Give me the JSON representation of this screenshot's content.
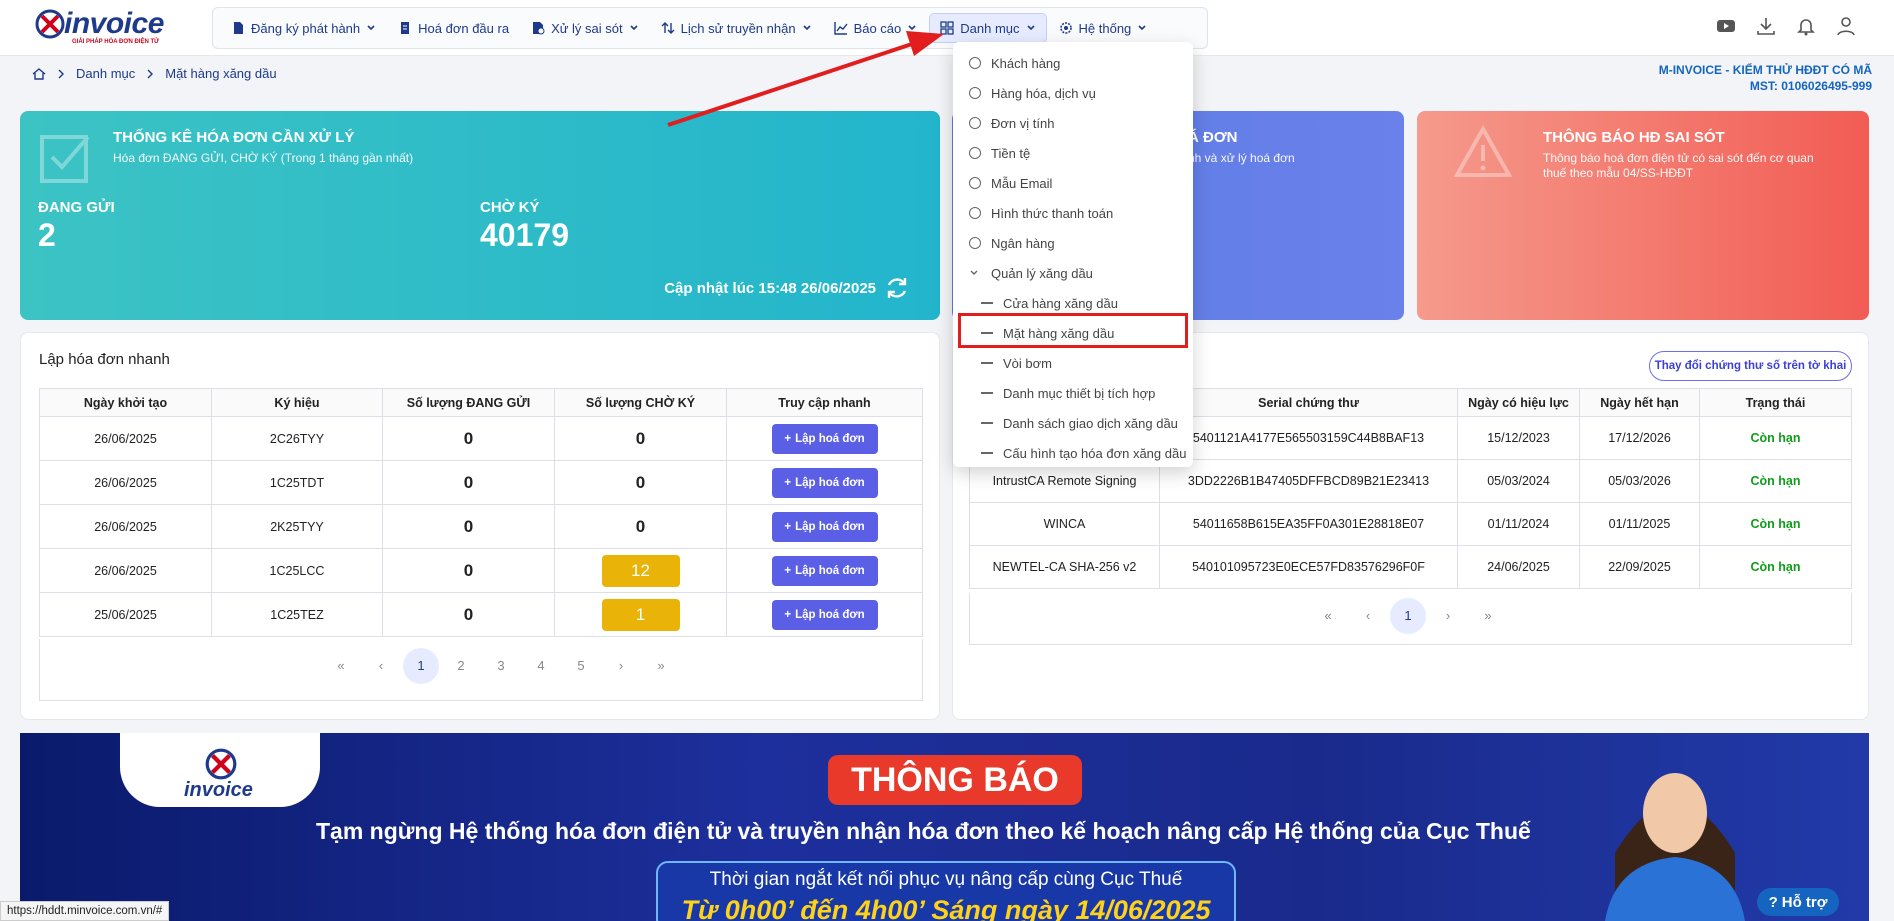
{
  "header": {
    "logo_text": "invoice",
    "logo_tagline": "GIẢI PHÁP HÓA ĐƠN ĐIỆN TỬ",
    "nav": [
      {
        "label": "Đăng ký phát hành",
        "icon": "file-register-icon"
      },
      {
        "label": "Hoá đơn đầu ra",
        "icon": "invoice-out-icon"
      },
      {
        "label": "Xử lý sai sót",
        "icon": "error-handling-icon"
      },
      {
        "label": "Lịch sử truyền nhận",
        "icon": "transfer-history-icon"
      },
      {
        "label": "Báo cáo",
        "icon": "chart-icon"
      },
      {
        "label": "Danh mục",
        "icon": "grid-icon"
      },
      {
        "label": "Hệ thống",
        "icon": "gear-icon"
      }
    ]
  },
  "breadcrumb": [
    "Danh mục",
    "Mặt hàng xăng dầu"
  ],
  "company": {
    "name": "M-INVOICE - KIỂM THỬ HĐĐT CÓ MÃ",
    "tax": "MST: 0106026495-999"
  },
  "stats": {
    "title": "THỐNG KÊ HÓA ĐƠN CẦN XỬ LÝ",
    "subtitle": "Hóa đơn ĐANG GỬI, CHỜ KÝ (Trong 1 tháng gần nhất)",
    "sending_label": "ĐANG GỬI",
    "sending_value": "2",
    "pending_label": "CHỜ KÝ",
    "pending_value": "40179",
    "updated": "Cập nhật lúc 15:48 26/06/2025"
  },
  "card2": {
    "title_partial": "Á ĐƠN",
    "sub_partial": "nh và xử lý hoá đơn"
  },
  "card3": {
    "title": "THÔNG BÁO HĐ SAI SÓT",
    "sub1": "Thông báo hoá đơn điện tử có sai sót đến cơ quan",
    "sub2": "thuế theo mẫu 04/SS-HĐĐT"
  },
  "quick": {
    "title": "Lập hóa đơn nhanh",
    "columns": [
      "Ngày khởi tạo",
      "Ký hiệu",
      "Số lượng ĐANG GỬI",
      "Số lượng CHỜ KÝ",
      "Truy cập nhanh"
    ],
    "button_label": "Lập hoá đơn",
    "rows": [
      {
        "date": "26/06/2025",
        "code": "2C26TYY",
        "sending": "0",
        "pending": "0"
      },
      {
        "date": "26/06/2025",
        "code": "1C25TDT",
        "sending": "0",
        "pending": "0"
      },
      {
        "date": "26/06/2025",
        "code": "2K25TYY",
        "sending": "0",
        "pending": "0"
      },
      {
        "date": "26/06/2025",
        "code": "1C25LCC",
        "sending": "0",
        "pending": "12"
      },
      {
        "date": "25/06/2025",
        "code": "1C25TEZ",
        "sending": "0",
        "pending": "1"
      }
    ],
    "pages": [
      "«",
      "‹",
      "1",
      "2",
      "3",
      "4",
      "5",
      "›",
      "»"
    ]
  },
  "certs": {
    "change_button": "Thay đổi chứng thư số trên tờ khai",
    "columns": [
      "",
      "Serial chứng thư",
      "Ngày có hiệu lực",
      "Ngày hết hạn",
      "Trạng thái"
    ],
    "rows": [
      {
        "provider": "",
        "serial": "5401121A4177E565503159C44B8BAF13",
        "from": "15/12/2023",
        "to": "17/12/2026",
        "status": "Còn hạn"
      },
      {
        "provider": "IntrustCA Remote Signing",
        "serial": "3DD2226B1B47405DFFBCD89B21E23413",
        "from": "05/03/2024",
        "to": "05/03/2026",
        "status": "Còn hạn"
      },
      {
        "provider": "WINCA",
        "serial": "54011658B615EA35FF0A301E28818E07",
        "from": "01/11/2024",
        "to": "01/11/2025",
        "status": "Còn hạn"
      },
      {
        "provider": "NEWTEL-CA SHA-256 v2",
        "serial": "540101095723E0ECE57FD83576296F0F",
        "from": "24/06/2025",
        "to": "22/09/2025",
        "status": "Còn hạn"
      }
    ],
    "pages": [
      "«",
      "‹",
      "1",
      "›",
      "»"
    ]
  },
  "dropdown": [
    {
      "label": "Khách hàng",
      "kind": "circle"
    },
    {
      "label": "Hàng hóa, dịch vụ",
      "kind": "circle"
    },
    {
      "label": "Đơn vị tính",
      "kind": "circle"
    },
    {
      "label": "Tiền tệ",
      "kind": "circle"
    },
    {
      "label": "Mẫu Email",
      "kind": "circle"
    },
    {
      "label": "Hình thức thanh toán",
      "kind": "circle"
    },
    {
      "label": "Ngân hàng",
      "kind": "circle"
    },
    {
      "label": "Quản lý xăng dầu",
      "kind": "caret"
    },
    {
      "label": "Cửa hàng xăng dầu",
      "kind": "dash"
    },
    {
      "label": "Mặt hàng xăng dầu",
      "kind": "dash"
    },
    {
      "label": "Vòi bơm",
      "kind": "dash"
    },
    {
      "label": "Danh mục thiết bị tích hợp",
      "kind": "dash"
    },
    {
      "label": "Danh sách giao dịch xăng dầu",
      "kind": "dash"
    },
    {
      "label": "Cấu hình tạo hóa đơn xăng dầu",
      "kind": "dash"
    }
  ],
  "banner": {
    "logo_text": "invoice",
    "title": "THÔNG BÁO",
    "text": "Tạm ngừng Hệ thống hóa đơn điện tử và truyền nhận hóa đơn theo kế hoạch nâng cấp Hệ thống của Cục Thuế",
    "time_label": "Thời gian ngắt kết nối phục vụ nâng cấp cùng Cục Thuế",
    "time_value": "Từ 0h00’ đến 4h00’ Sáng ngày 14/06/2025"
  },
  "help_label": "Hỗ trợ",
  "status_url": "https://hddt.minvoice.com.vn/#",
  "colors": {
    "accent": "#5b5fe6",
    "brand": "#1e3a8a",
    "highlight": "#e11d1d",
    "pending": "#eab308",
    "valid": "#0f9d1a"
  }
}
